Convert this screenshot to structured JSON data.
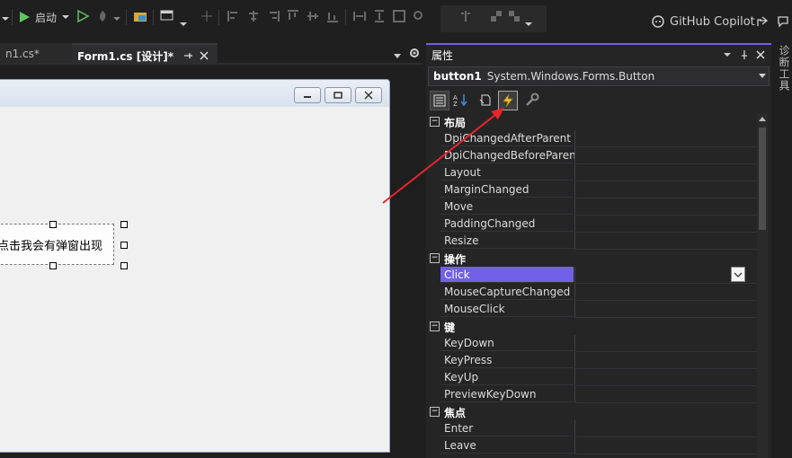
{
  "toolbar": {
    "start_label": "启动",
    "copilot_label": "GitHub Copilot"
  },
  "tabs": [
    {
      "label": "n1.cs*"
    },
    {
      "label": "Form1.cs [设计]*"
    }
  ],
  "form": {
    "button_text": "点击我会有弹窗出现"
  },
  "properties": {
    "title": "属性",
    "object_name": "button1",
    "object_type": "System.Windows.Forms.Button",
    "categories": [
      {
        "label": "布局",
        "items": [
          "DpiChangedAfterParent",
          "DpiChangedBeforeParen",
          "Layout",
          "MarginChanged",
          "Move",
          "PaddingChanged",
          "Resize"
        ]
      },
      {
        "label": "操作",
        "items": [
          "Click",
          "MouseCaptureChanged",
          "MouseClick"
        ]
      },
      {
        "label": "键",
        "items": [
          "KeyDown",
          "KeyPress",
          "KeyUp",
          "PreviewKeyDown"
        ]
      },
      {
        "label": "焦点",
        "items": [
          "Enter",
          "Leave"
        ]
      }
    ],
    "selected": "Click"
  },
  "side_panel": {
    "label": "诊断工具"
  },
  "colors": {
    "accent": "#7160e8",
    "annotation_arrow": "#e8262c"
  }
}
